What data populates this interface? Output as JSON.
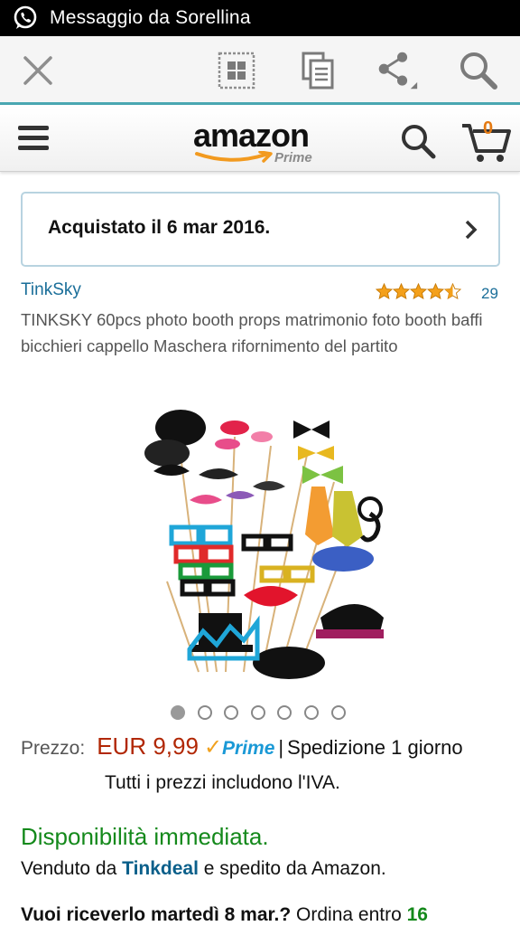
{
  "status_bar": {
    "notification_text": "Messaggio da Sorellina",
    "notification_icon": "whatsapp-icon"
  },
  "toolbar": {
    "icons": [
      "close-icon",
      "tabs-grid-icon",
      "copy-page-icon",
      "share-icon",
      "search-icon"
    ],
    "accent_color": "#4aa7b2"
  },
  "header": {
    "logo_word": "amazon",
    "logo_sub": "Prime",
    "cart_count": "0"
  },
  "purchase_notice": {
    "text": "Acquistato il 6 mar 2016."
  },
  "product": {
    "brand": "TinkSky",
    "rating": 4.5,
    "review_count": "29",
    "title": "TINKSKY 60pcs photo booth props matrimonio foto booth baffi bicchieri cappello Maschera rifornimento del partito",
    "image_count": 7,
    "active_image_index": 0
  },
  "price": {
    "label": "Prezzo:",
    "value": "EUR 9,99",
    "prime_label": "Prime",
    "separator": "|",
    "shipping": "Spedizione 1 giorno",
    "vat_note": "Tutti i prezzi includono l'IVA.",
    "price_color": "#b12704"
  },
  "availability": {
    "status": "Disponibilità immediata.",
    "sold_by_prefix": "Venduto da",
    "seller": "Tinkdeal",
    "sold_by_suffix": "e spedito da Amazon.",
    "delivery_question": "Vuoi riceverlo martedì 8 mar.?",
    "delivery_order": "Ordina entro",
    "delivery_hours": "16",
    "status_color": "#14891b"
  }
}
